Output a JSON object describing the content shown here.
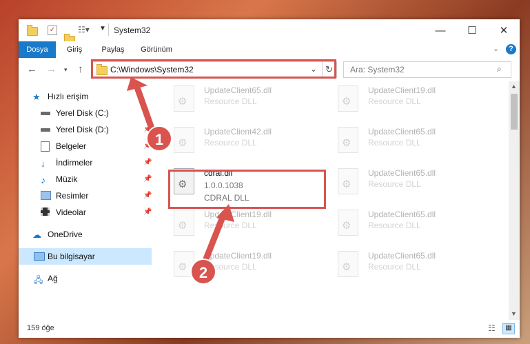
{
  "window": {
    "title": "System32"
  },
  "ribbon": {
    "tabs": [
      {
        "label": "Dosya"
      },
      {
        "label": "Giriş"
      },
      {
        "label": "Paylaş"
      },
      {
        "label": "Görünüm"
      }
    ]
  },
  "navigation": {
    "address": "C:\\Windows\\System32",
    "search_placeholder": "Ara: System32"
  },
  "sidebar": {
    "items": [
      {
        "label": "Hızlı erişim",
        "icon": "star-icon"
      },
      {
        "label": "Yerel Disk (C:)",
        "icon": "drive-icon"
      },
      {
        "label": "Yerel Disk (D:)",
        "icon": "drive-icon"
      },
      {
        "label": "Belgeler",
        "icon": "documents-icon"
      },
      {
        "label": "İndirmeler",
        "icon": "download-icon"
      },
      {
        "label": "Müzik",
        "icon": "music-icon"
      },
      {
        "label": "Resimler",
        "icon": "pictures-icon"
      },
      {
        "label": "Videolar",
        "icon": "video-icon"
      },
      {
        "label": "OneDrive",
        "icon": "cloud-icon"
      },
      {
        "label": "Bu bilgisayar",
        "icon": "computer-icon"
      },
      {
        "label": "Ağ",
        "icon": "network-icon"
      }
    ]
  },
  "files": [
    {
      "name": "UpdateClient65.dll",
      "type": "Resource DLL"
    },
    {
      "name": "UpdateClient19.dll",
      "type": "Resource DLL"
    },
    {
      "name": "UpdateClient42.dll",
      "type": "Resource DLL"
    },
    {
      "name": "UpdateClient65.dll",
      "type": "Resource DLL"
    },
    {
      "name": "cdral.dll",
      "version": "1.0.0.1038",
      "type": "CDRAL DLL"
    },
    {
      "name": "UpdateClient65.dll",
      "type": "Resource DLL"
    },
    {
      "name": "UpdateClient19.dll",
      "type": "Resource DLL"
    },
    {
      "name": "UpdateClient65.dll",
      "type": "Resource DLL"
    },
    {
      "name": "UpdateClient19.dll",
      "type": "Resource DLL"
    },
    {
      "name": "UpdateClient65.dll",
      "type": "Resource DLL"
    }
  ],
  "status": {
    "item_count": "159 öğe"
  },
  "annotations": {
    "step1": "1",
    "step2": "2"
  },
  "colors": {
    "accent": "#1979ca",
    "highlight": "#d9534f",
    "selection": "#cce8ff"
  }
}
